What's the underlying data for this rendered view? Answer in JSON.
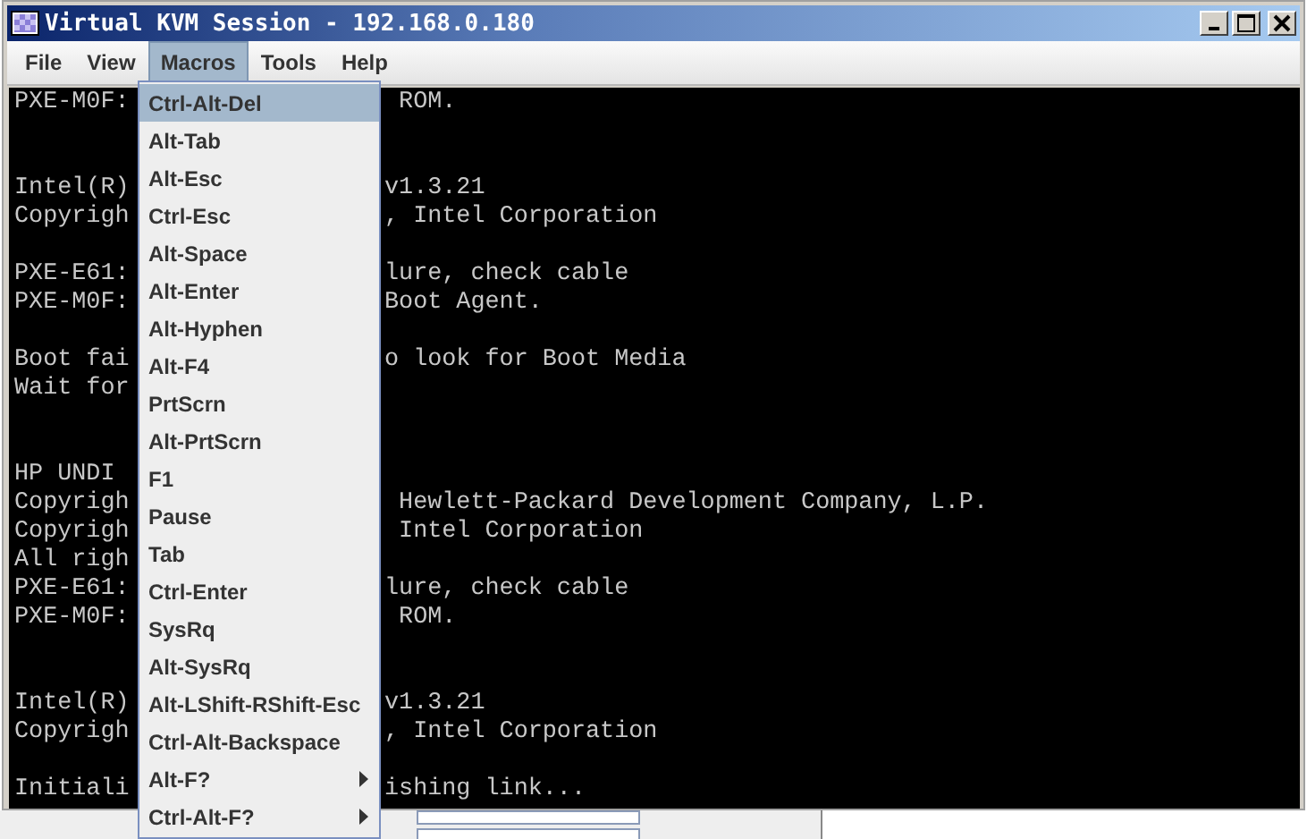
{
  "window": {
    "title": "Virtual KVM Session - 192.168.0.180"
  },
  "menubar": [
    {
      "label": "File",
      "selected": false
    },
    {
      "label": "View",
      "selected": false
    },
    {
      "label": "Macros",
      "selected": true
    },
    {
      "label": "Tools",
      "selected": false
    },
    {
      "label": "Help",
      "selected": false
    }
  ],
  "console_lines": [
    {
      "kind": "text",
      "left": "PXE-M0F:",
      "right": " ROM."
    },
    {
      "kind": "blank"
    },
    {
      "kind": "blank"
    },
    {
      "kind": "text",
      "left": "Intel(R)",
      "right": "v1.3.21"
    },
    {
      "kind": "text",
      "left": "Copyrigh",
      "right": ", Intel Corporation"
    },
    {
      "kind": "blank"
    },
    {
      "kind": "text",
      "left": "PXE-E61:",
      "right": "lure, check cable"
    },
    {
      "kind": "text",
      "left": "PXE-M0F:",
      "right": "Boot Agent."
    },
    {
      "kind": "blank"
    },
    {
      "kind": "text",
      "left": "Boot fai",
      "right": "o look for Boot Media"
    },
    {
      "kind": "text",
      "left": "Wait for"
    },
    {
      "kind": "blank"
    },
    {
      "kind": "blank"
    },
    {
      "kind": "text",
      "left": "HP UNDI"
    },
    {
      "kind": "text",
      "left": "Copyrigh",
      "right": " Hewlett-Packard Development Company, L.P."
    },
    {
      "kind": "text",
      "left": "Copyrigh",
      "right": " Intel Corporation"
    },
    {
      "kind": "text",
      "left": "All righ"
    },
    {
      "kind": "text",
      "left": "PXE-E61:",
      "right": "lure, check cable"
    },
    {
      "kind": "text",
      "left": "PXE-M0F:",
      "right": " ROM."
    },
    {
      "kind": "blank"
    },
    {
      "kind": "blank"
    },
    {
      "kind": "text",
      "left": "Intel(R)",
      "right": "v1.3.21"
    },
    {
      "kind": "text",
      "left": "Copyrigh",
      "right": ", Intel Corporation"
    },
    {
      "kind": "blank"
    },
    {
      "kind": "text",
      "left": "Initiali",
      "right": "ishing link..."
    }
  ],
  "macros_menu": [
    {
      "label": "Ctrl-Alt-Del",
      "kind": "item",
      "selected": true
    },
    {
      "label": "Alt-Tab",
      "kind": "item",
      "selected": false
    },
    {
      "label": "Alt-Esc",
      "kind": "item",
      "selected": false
    },
    {
      "label": "Ctrl-Esc",
      "kind": "item",
      "selected": false
    },
    {
      "label": "Alt-Space",
      "kind": "item",
      "selected": false
    },
    {
      "label": "Alt-Enter",
      "kind": "item",
      "selected": false
    },
    {
      "label": "Alt-Hyphen",
      "kind": "item",
      "selected": false
    },
    {
      "label": "Alt-F4",
      "kind": "item",
      "selected": false
    },
    {
      "label": "PrtScrn",
      "kind": "item",
      "selected": false
    },
    {
      "label": "Alt-PrtScrn",
      "kind": "item",
      "selected": false
    },
    {
      "label": "F1",
      "kind": "item",
      "selected": false
    },
    {
      "label": "Pause",
      "kind": "item",
      "selected": false
    },
    {
      "label": "Tab",
      "kind": "item",
      "selected": false
    },
    {
      "label": "Ctrl-Enter",
      "kind": "item",
      "selected": false
    },
    {
      "label": "SysRq",
      "kind": "item",
      "selected": false
    },
    {
      "label": "Alt-SysRq",
      "kind": "item",
      "selected": false
    },
    {
      "label": "Alt-LShift-RShift-Esc",
      "kind": "item",
      "selected": false
    },
    {
      "label": "Ctrl-Alt-Backspace",
      "kind": "item",
      "selected": false
    },
    {
      "label": "Alt-F?",
      "kind": "submenu",
      "selected": false
    },
    {
      "label": "Ctrl-Alt-F?",
      "kind": "submenu",
      "selected": false
    }
  ]
}
